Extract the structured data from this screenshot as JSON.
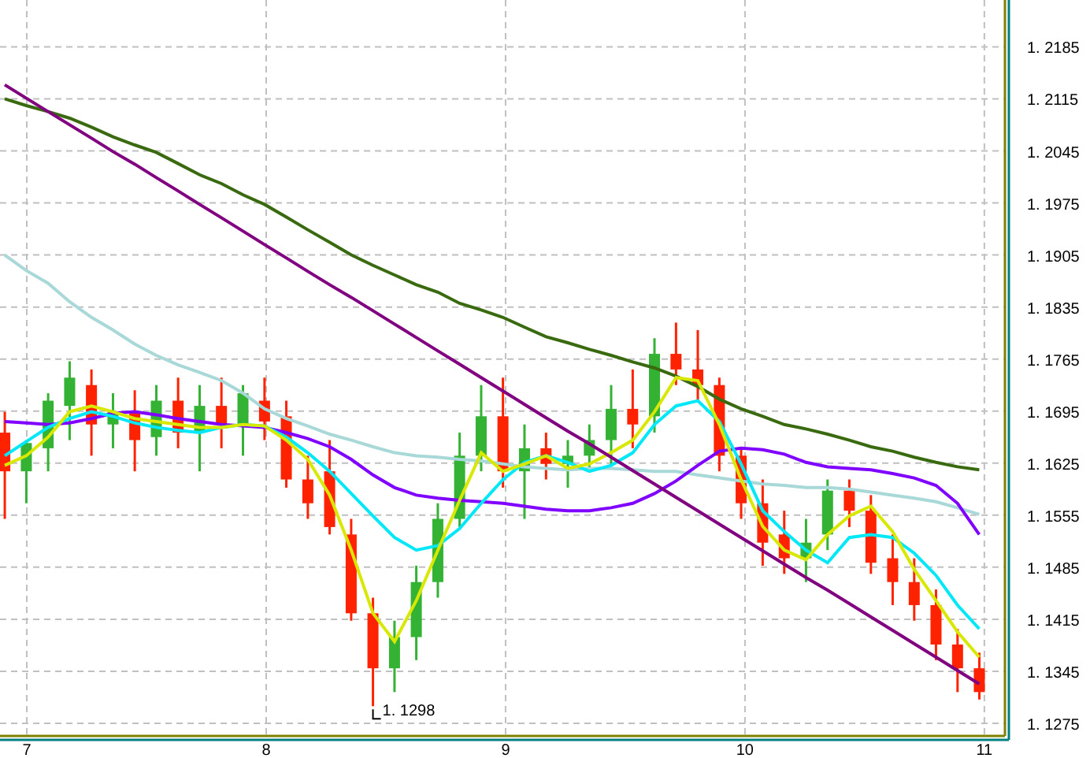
{
  "chart": {
    "chart_data": {
      "type": "candlestick",
      "grid": true,
      "x": [
        6.908,
        6.998,
        7.089,
        7.179,
        7.27,
        7.36,
        7.451,
        7.541,
        7.632,
        7.722,
        7.813,
        7.903,
        7.993,
        8.084,
        8.174,
        8.265,
        8.355,
        8.446,
        8.536,
        8.627,
        8.717,
        8.808,
        8.898,
        8.989,
        9.079,
        9.169,
        9.26,
        9.35,
        9.441,
        9.531,
        9.622,
        9.712,
        9.803,
        9.893,
        9.984,
        10.074,
        10.164,
        10.255,
        10.345,
        10.436,
        10.526,
        10.617,
        10.707,
        10.798,
        10.888,
        10.979
      ],
      "xlim": [
        6.888,
        11.086
      ],
      "xticks": [
        7,
        8,
        9,
        10,
        11
      ],
      "ylim": [
        1.1258,
        1.2248
      ],
      "yticks": [
        1.2185,
        1.2115,
        1.2045,
        1.1975,
        1.1905,
        1.1835,
        1.1765,
        1.1695,
        1.1625,
        1.1555,
        1.1485,
        1.1415,
        1.1345,
        1.1275
      ],
      "series": [
        {
          "type": "line",
          "color": "#a8d8d8",
          "values": [
            1.1905,
            1.1884,
            1.1867,
            1.1842,
            1.1821,
            1.1804,
            1.1785,
            1.177,
            1.1757,
            1.1747,
            1.1736,
            1.1719,
            1.1698,
            1.1685,
            1.1675,
            1.1664,
            1.1656,
            1.1647,
            1.1639,
            1.1635,
            1.1633,
            1.163,
            1.1628,
            1.1624,
            1.162,
            1.1618,
            1.1616,
            1.1618,
            1.1618,
            1.1616,
            1.1614,
            1.1614,
            1.1609,
            1.1605,
            1.1601,
            1.1597,
            1.1595,
            1.1592,
            1.1592,
            1.159,
            1.1586,
            1.1582,
            1.1578,
            1.1573,
            1.1565,
            1.1556
          ]
        },
        {
          "type": "line",
          "color": "#3a6a10",
          "values": [
            1.2115,
            1.2106,
            1.2098,
            1.2089,
            1.2077,
            1.2064,
            1.2053,
            1.2043,
            1.2028,
            1.2013,
            1.2001,
            1.1986,
            1.1973,
            1.1956,
            1.1939,
            1.1922,
            1.1905,
            1.1891,
            1.1878,
            1.1865,
            1.1855,
            1.184,
            1.1831,
            1.1821,
            1.1808,
            1.1795,
            1.1787,
            1.1778,
            1.177,
            1.1761,
            1.1753,
            1.1742,
            1.1728,
            1.1711,
            1.1698,
            1.1688,
            1.1677,
            1.1671,
            1.1664,
            1.1656,
            1.1647,
            1.1641,
            1.1633,
            1.1626,
            1.162,
            1.1616
          ]
        },
        {
          "type": "line",
          "color": "#8000ff",
          "values": [
            1.1681,
            1.1679,
            1.1677,
            1.1679,
            1.1685,
            1.1692,
            1.1694,
            1.169,
            1.1685,
            1.1681,
            1.1677,
            1.1675,
            1.1673,
            1.1666,
            1.1658,
            1.1647,
            1.163,
            1.1609,
            1.1592,
            1.1582,
            1.1578,
            1.1575,
            1.1573,
            1.1571,
            1.1567,
            1.1563,
            1.1561,
            1.1561,
            1.1565,
            1.1571,
            1.1584,
            1.1601,
            1.1622,
            1.1641,
            1.1645,
            1.1643,
            1.1637,
            1.1626,
            1.162,
            1.1618,
            1.1616,
            1.1611,
            1.1605,
            1.1595,
            1.1571,
            1.1529
          ]
        },
        {
          "type": "line",
          "color": "#00e8f8",
          "values": [
            1.1635,
            1.1654,
            1.1673,
            1.1685,
            1.1694,
            1.1688,
            1.1679,
            1.1673,
            1.1669,
            1.1666,
            1.1673,
            1.1677,
            1.1675,
            1.166,
            1.1639,
            1.1614,
            1.1584,
            1.1554,
            1.1525,
            1.1508,
            1.1514,
            1.1537,
            1.1571,
            1.1603,
            1.1626,
            1.1635,
            1.1626,
            1.1614,
            1.1622,
            1.1639,
            1.1677,
            1.1702,
            1.1709,
            1.1681,
            1.1624,
            1.1561,
            1.1533,
            1.1508,
            1.1491,
            1.1525,
            1.1529,
            1.1525,
            1.1504,
            1.1474,
            1.1434,
            1.1402
          ]
        },
        {
          "type": "line",
          "color": "#d8e800",
          "values": [
            1.1622,
            1.1635,
            1.166,
            1.1694,
            1.1702,
            1.1694,
            1.1685,
            1.1681,
            1.1677,
            1.1673,
            1.1673,
            1.1677,
            1.1675,
            1.1656,
            1.163,
            1.1582,
            1.1508,
            1.1423,
            1.1385,
            1.144,
            1.1508,
            1.1575,
            1.1639,
            1.1614,
            1.1624,
            1.1635,
            1.1618,
            1.1624,
            1.1639,
            1.1656,
            1.1694,
            1.174,
            1.1736,
            1.1677,
            1.1603,
            1.154,
            1.1508,
            1.1495,
            1.1529,
            1.1554,
            1.1567,
            1.1533,
            1.1482,
            1.144,
            1.1398,
            1.1364
          ]
        },
        {
          "type": "line",
          "color": "#800080",
          "values": [
            1.2134,
            1.2116,
            1.2098,
            1.208,
            1.2062,
            1.2044,
            1.2027,
            1.2009,
            1.1991,
            1.1973,
            1.1955,
            1.1937,
            1.1919,
            1.1901,
            1.1883,
            1.1865,
            1.1848,
            1.183,
            1.1812,
            1.1794,
            1.1776,
            1.1758,
            1.174,
            1.1722,
            1.1704,
            1.1686,
            1.1668,
            1.1651,
            1.1633,
            1.1615,
            1.1597,
            1.1579,
            1.1561,
            1.1543,
            1.1525,
            1.1507,
            1.1489,
            1.1471,
            1.1454,
            1.1436,
            1.1418,
            1.14,
            1.1382,
            1.1364,
            1.1346,
            1.1328
          ]
        }
      ],
      "ohlc": [
        [
          1.1666,
          1.1694,
          1.155,
          1.1614
        ],
        [
          1.1614,
          1.1656,
          1.1571,
          1.1652
        ],
        [
          1.1645,
          1.1719,
          1.1614,
          1.1709
        ],
        [
          1.1702,
          1.1762,
          1.1656,
          1.174
        ],
        [
          1.173,
          1.1751,
          1.1635,
          1.1677
        ],
        [
          1.1677,
          1.1719,
          1.1645,
          1.1694
        ],
        [
          1.1694,
          1.1723,
          1.1614,
          1.1656
        ],
        [
          1.166,
          1.173,
          1.1635,
          1.1709
        ],
        [
          1.1709,
          1.174,
          1.1645,
          1.1666
        ],
        [
          1.1666,
          1.173,
          1.1614,
          1.1702
        ],
        [
          1.1702,
          1.174,
          1.1645,
          1.1677
        ],
        [
          1.1677,
          1.173,
          1.1635,
          1.1719
        ],
        [
          1.1709,
          1.174,
          1.1656,
          1.1681
        ],
        [
          1.1688,
          1.1709,
          1.1592,
          1.1603
        ],
        [
          1.1603,
          1.1635,
          1.155,
          1.1571
        ],
        [
          1.1614,
          1.1656,
          1.1529,
          1.1539
        ],
        [
          1.1529,
          1.155,
          1.1413,
          1.1423
        ],
        [
          1.1423,
          1.1444,
          1.1298,
          1.1349
        ],
        [
          1.1349,
          1.1413,
          1.1317,
          1.1391
        ],
        [
          1.1391,
          1.1487,
          1.136,
          1.1465
        ],
        [
          1.1465,
          1.1571,
          1.1444,
          1.155
        ],
        [
          1.155,
          1.1666,
          1.1539,
          1.1635
        ],
        [
          1.1635,
          1.173,
          1.1614,
          1.1688
        ],
        [
          1.1688,
          1.174,
          1.1592,
          1.1614
        ],
        [
          1.1614,
          1.1677,
          1.155,
          1.1645
        ],
        [
          1.1645,
          1.1666,
          1.1603,
          1.1624
        ],
        [
          1.1624,
          1.1656,
          1.1592,
          1.1635
        ],
        [
          1.1635,
          1.1677,
          1.1614,
          1.1656
        ],
        [
          1.1656,
          1.173,
          1.1624,
          1.1698
        ],
        [
          1.1698,
          1.1751,
          1.1645,
          1.1677
        ],
        [
          1.1688,
          1.1793,
          1.1666,
          1.1772
        ],
        [
          1.1772,
          1.1814,
          1.173,
          1.1751
        ],
        [
          1.1751,
          1.1804,
          1.1709,
          1.173
        ],
        [
          1.173,
          1.174,
          1.1614,
          1.1635
        ],
        [
          1.1635,
          1.1645,
          1.155,
          1.1571
        ],
        [
          1.1571,
          1.1603,
          1.1487,
          1.1518
        ],
        [
          1.1529,
          1.1561,
          1.1476,
          1.1497
        ],
        [
          1.1497,
          1.155,
          1.1465,
          1.1518
        ],
        [
          1.1529,
          1.1603,
          1.1508,
          1.1588
        ],
        [
          1.1588,
          1.1603,
          1.1539,
          1.1561
        ],
        [
          1.1561,
          1.1582,
          1.1476,
          1.1491
        ],
        [
          1.1497,
          1.1529,
          1.1434,
          1.1465
        ],
        [
          1.1465,
          1.1497,
          1.1413,
          1.1434
        ],
        [
          1.1434,
          1.1455,
          1.136,
          1.1381
        ],
        [
          1.1381,
          1.1402,
          1.1317,
          1.1349
        ],
        [
          1.1349,
          1.137,
          1.1307,
          1.1317
        ]
      ],
      "annotations": [
        "1. 1298"
      ]
    }
  }
}
